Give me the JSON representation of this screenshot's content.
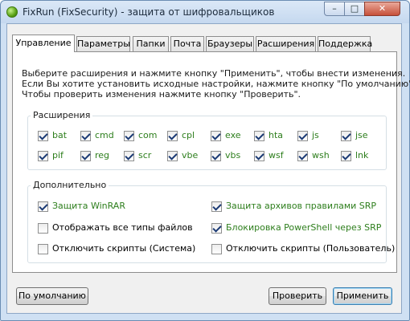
{
  "window": {
    "title": "FixRun (FixSecurity) - защита от шифровальщиков",
    "controls": {
      "minimize": "–",
      "maximize": "□",
      "close": "✕"
    }
  },
  "tabs": [
    "Управление",
    "Параметры",
    "Папки",
    "Почта",
    "Браузеры",
    "Расширения",
    "Поддержка"
  ],
  "active_tab": "Управление",
  "info": {
    "line1": "Выберите расширения и нажмите кнопку \"Применить\", чтобы внести изменения.",
    "line2": "Если Вы хотите установить исходные настройки, нажмите кнопку \"По умолчанию\".",
    "line3": "Чтобы проверить изменения нажмите кнопку \"Проверить\"."
  },
  "extensions": {
    "title": "Расширения",
    "items": [
      {
        "label": "bat",
        "checked": true
      },
      {
        "label": "cmd",
        "checked": true
      },
      {
        "label": "com",
        "checked": true
      },
      {
        "label": "cpl",
        "checked": true
      },
      {
        "label": "exe",
        "checked": true
      },
      {
        "label": "hta",
        "checked": true
      },
      {
        "label": "js",
        "checked": true
      },
      {
        "label": "jse",
        "checked": true
      },
      {
        "label": "pif",
        "checked": true
      },
      {
        "label": "reg",
        "checked": true
      },
      {
        "label": "scr",
        "checked": true
      },
      {
        "label": "vbe",
        "checked": true
      },
      {
        "label": "vbs",
        "checked": true
      },
      {
        "label": "wsf",
        "checked": true
      },
      {
        "label": "wsh",
        "checked": true
      },
      {
        "label": "lnk",
        "checked": true
      }
    ]
  },
  "additional": {
    "title": "Дополнительно",
    "items": [
      {
        "label": "Защита WinRAR",
        "checked": true,
        "color": "#2d7e1c"
      },
      {
        "label": "Защита архивов правилами SRP",
        "checked": true,
        "color": "#2d7e1c"
      },
      {
        "label": "Отображать все типы файлов",
        "checked": false,
        "color": "#000000"
      },
      {
        "label": "Блокировка PowerShell через SRP",
        "checked": true,
        "color": "#2d7e1c"
      },
      {
        "label": "Отключить скрипты (Система)",
        "checked": false,
        "color": "#000000"
      },
      {
        "label": "Отключить скрипты (Пользователь)",
        "checked": false,
        "color": "#000000"
      }
    ]
  },
  "buttons": {
    "default": "По умолчанию",
    "check": "Проверить",
    "apply": "Применить"
  },
  "colors": {
    "label_green": "#2d7e1c",
    "check_mark": "#1b3a74"
  }
}
